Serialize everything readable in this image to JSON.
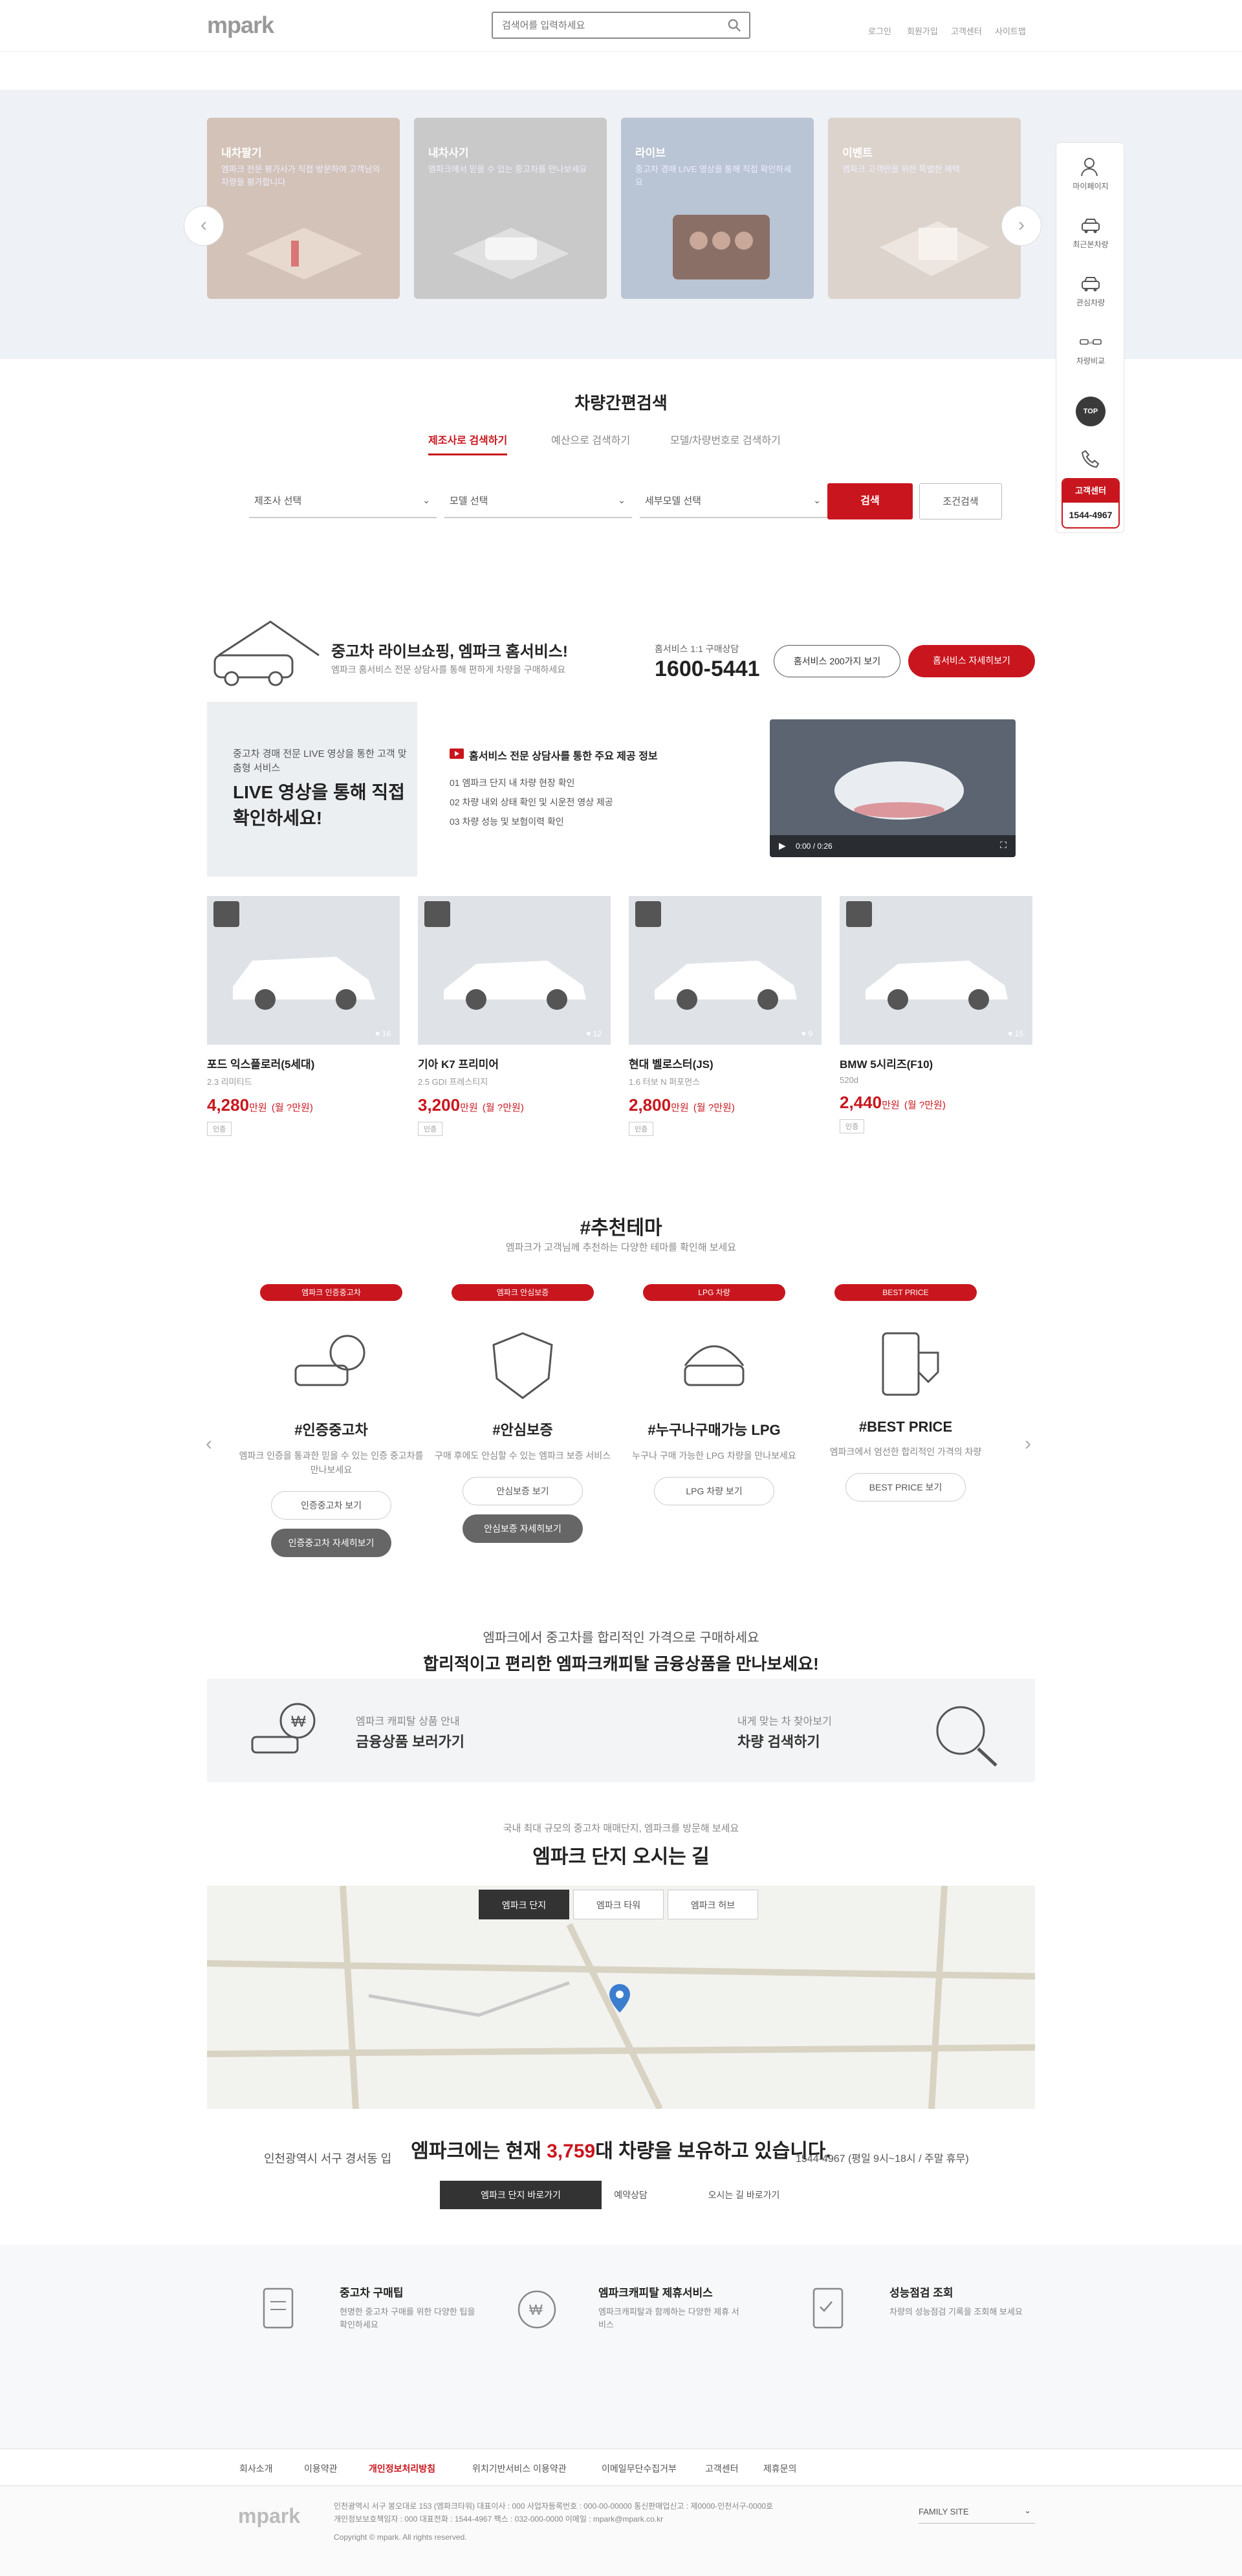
{
  "header": {
    "logo": "mpark",
    "search_placeholder": "검색어를 입력하세요",
    "util_links": [
      "로그인",
      "회원가입",
      "고객센터",
      "사이트맵"
    ]
  },
  "banner": {
    "cards": [
      {
        "title": "내차팔기",
        "sub": "엠파크 전문 평가사가 직접 방문하여 고객님의 차량을 평가합니다"
      },
      {
        "title": "내차사기",
        "sub": "엠파크에서 믿을 수 있는 중고차를 만나보세요"
      },
      {
        "title": "라이브",
        "sub": "중고차 경매 LIVE 영상을 통해 직접 확인하세요"
      },
      {
        "title": "이벤트",
        "sub": "엠파크 고객만을 위한 특별한 혜택"
      }
    ],
    "prev": "‹",
    "next": "›"
  },
  "side": {
    "items": [
      "마이페이지",
      "최근본차량",
      "관심차량",
      "차량비교"
    ],
    "top": "TOP",
    "cs_label": "고객센터",
    "cs_number": "1544-4967"
  },
  "search_section": {
    "title": "차량간편검색",
    "tabs": [
      "제조사로 검색하기",
      "예산으로 검색하기",
      "모델/차량번호로 검색하기"
    ],
    "selects": [
      "제조사 선택",
      "모델 선택",
      "세부모델 선택"
    ],
    "search_btn": "검색",
    "reset_btn": "조건검색"
  },
  "home_service": {
    "title": "중고차 라이브쇼핑, 엠파크 홈서비스!",
    "sub": "엠파크 홈서비스 전문 상담사를 통해 편하게 차량을 구매하세요",
    "call_label": "홈서비스 1:1 구매상담",
    "tel": "1600-5441",
    "pill1": "홈서비스 200가지 보기",
    "pill2": "홈서비스 자세히보기",
    "live_small": "중고차 경매 전문 LIVE 영상을 통한 고객 맞춤형 서비스",
    "live_big": "LIVE 영상을 통해 직접 확인하세요!",
    "live_head": "홈서비스 전문 상담사를 통한 주요 제공 정보",
    "live_list": [
      "01   엠파크 단지 내 차량 현장 확인",
      "02   차량 내외 상태 확인 및 시운전 영상 제공",
      "03   차량 성능 및 보험이력 확인"
    ],
    "video_time": "0:00 / 0:26"
  },
  "cars": [
    {
      "name": "포드 익스플로러(5세대)",
      "sub": "2.3 리미티드",
      "price": "4,280",
      "unit": "만원",
      "note": "(월 ?만원)",
      "tag": "인증",
      "likes": "♥ 16"
    },
    {
      "name": "기아 K7 프리미어",
      "sub": "2.5 GDI 프레스티지",
      "price": "3,200",
      "unit": "만원",
      "note": "(월 ?만원)",
      "tag": "인증",
      "likes": "♥ 12"
    },
    {
      "name": "현대 벨로스터(JS)",
      "sub": "1.6 터보 N 퍼포먼스",
      "price": "2,800",
      "unit": "만원",
      "note": "(월 ?만원)",
      "tag": "인증",
      "likes": "♥ 9"
    },
    {
      "name": "BMW 5시리즈(F10)",
      "sub": "520d",
      "price": "2,440",
      "unit": "만원",
      "note": "(월 ?만원)",
      "tag": "인증",
      "likes": "♥ 15"
    }
  ],
  "recommend": {
    "title": "#추천테마",
    "sub": "엠파크가 고객님께 추천하는 다양한 테마를 확인해 보세요",
    "items": [
      {
        "pill": "엠파크 인증중고차",
        "name": "#인증중고차",
        "desc": "엠파크 인증을 통과한 믿을 수 있는 인증 중고차를 만나보세요",
        "btn": "인증중고차 보기",
        "btn2": "인증중고차 자세히보기"
      },
      {
        "pill": "엠파크 안심보증",
        "name": "#안심보증",
        "desc": "구매 후에도 안심할 수 있는 엠파크 보증 서비스",
        "btn": "안심보증 보기",
        "btn2": "안심보증 자세히보기"
      },
      {
        "pill": "LPG 차량",
        "name": "#누구나구매가능 LPG",
        "desc": "누구나 구매 가능한 LPG 차량을 만나보세요",
        "btn": "LPG 차량 보기",
        "btn2": ""
      },
      {
        "pill": "BEST PRICE",
        "name": "#BEST PRICE",
        "desc": "엠파크에서 엄선한 합리적인 가격의 차량",
        "btn": "BEST PRICE 보기",
        "btn2": ""
      }
    ]
  },
  "finance": {
    "line1": "엠파크에서 중고차를 합리적인 가격으로 구매하세요",
    "line2": "합리적이고 편리한 엠파크캐피탈 금융상품을 만나보세요!",
    "left_small": "엠파크 캐피탈 상품 안내",
    "left_big": "금융상품 보러가기",
    "right_small": "내게 맞는 차 찾아보기",
    "right_big": "차량 검색하기"
  },
  "map_section": {
    "sub": "국내 최대 규모의 중고차 매매단지, 엠파크를 방문해 보세요",
    "title": "엠파크 단지 오시는 길",
    "tabs": [
      "엠파크 단지",
      "엠파크 타워",
      "엠파크 허브"
    ]
  },
  "count": {
    "pre": "엠파크에는 현재 ",
    "num": "3,759",
    "post": "대 차량을 보유하고 있습니다.",
    "left_label": "인천광역시 서구 경서동 입",
    "right_label": "1544-4967 (평일 9시~18시 / 주말 휴무)",
    "btns": [
      "엠파크 단지 바로가기",
      "예약상담",
      "오시는 길 바로가기"
    ]
  },
  "services": [
    {
      "title": "중고차 구매팁",
      "desc": "현명한 중고차 구매를 위한 다양한 팁을 확인하세요"
    },
    {
      "title": "엠파크캐피탈 제휴서비스",
      "desc": "엠파크캐피탈과 함께하는 다양한 제휴 서비스"
    },
    {
      "title": "성능점검 조회",
      "desc": "차량의 성능점검 기록을 조회해 보세요"
    }
  ],
  "footer_links": [
    "회사소개",
    "이용약관",
    "개인정보처리방침",
    "위치기반서비스 이용약관",
    "이메일무단수집거부",
    "고객센터",
    "제휴문의"
  ],
  "footer": {
    "logo": "mpark",
    "info1": "인천광역시 서구 봉오대로 153 (엠파크타워) 대표이사 : 000 사업자등록번호 : 000-00-00000 통신판매업신고 : 제0000-인천서구-0000호",
    "info2": "개인정보보호책임자 : 000  대표전화 : 1544-4967  팩스 : 032-000-0000  이메일 : mpark@mpark.co.kr",
    "copyright": "Copyright © mpark. All rights reserved.",
    "family": "FAMILY SITE"
  }
}
